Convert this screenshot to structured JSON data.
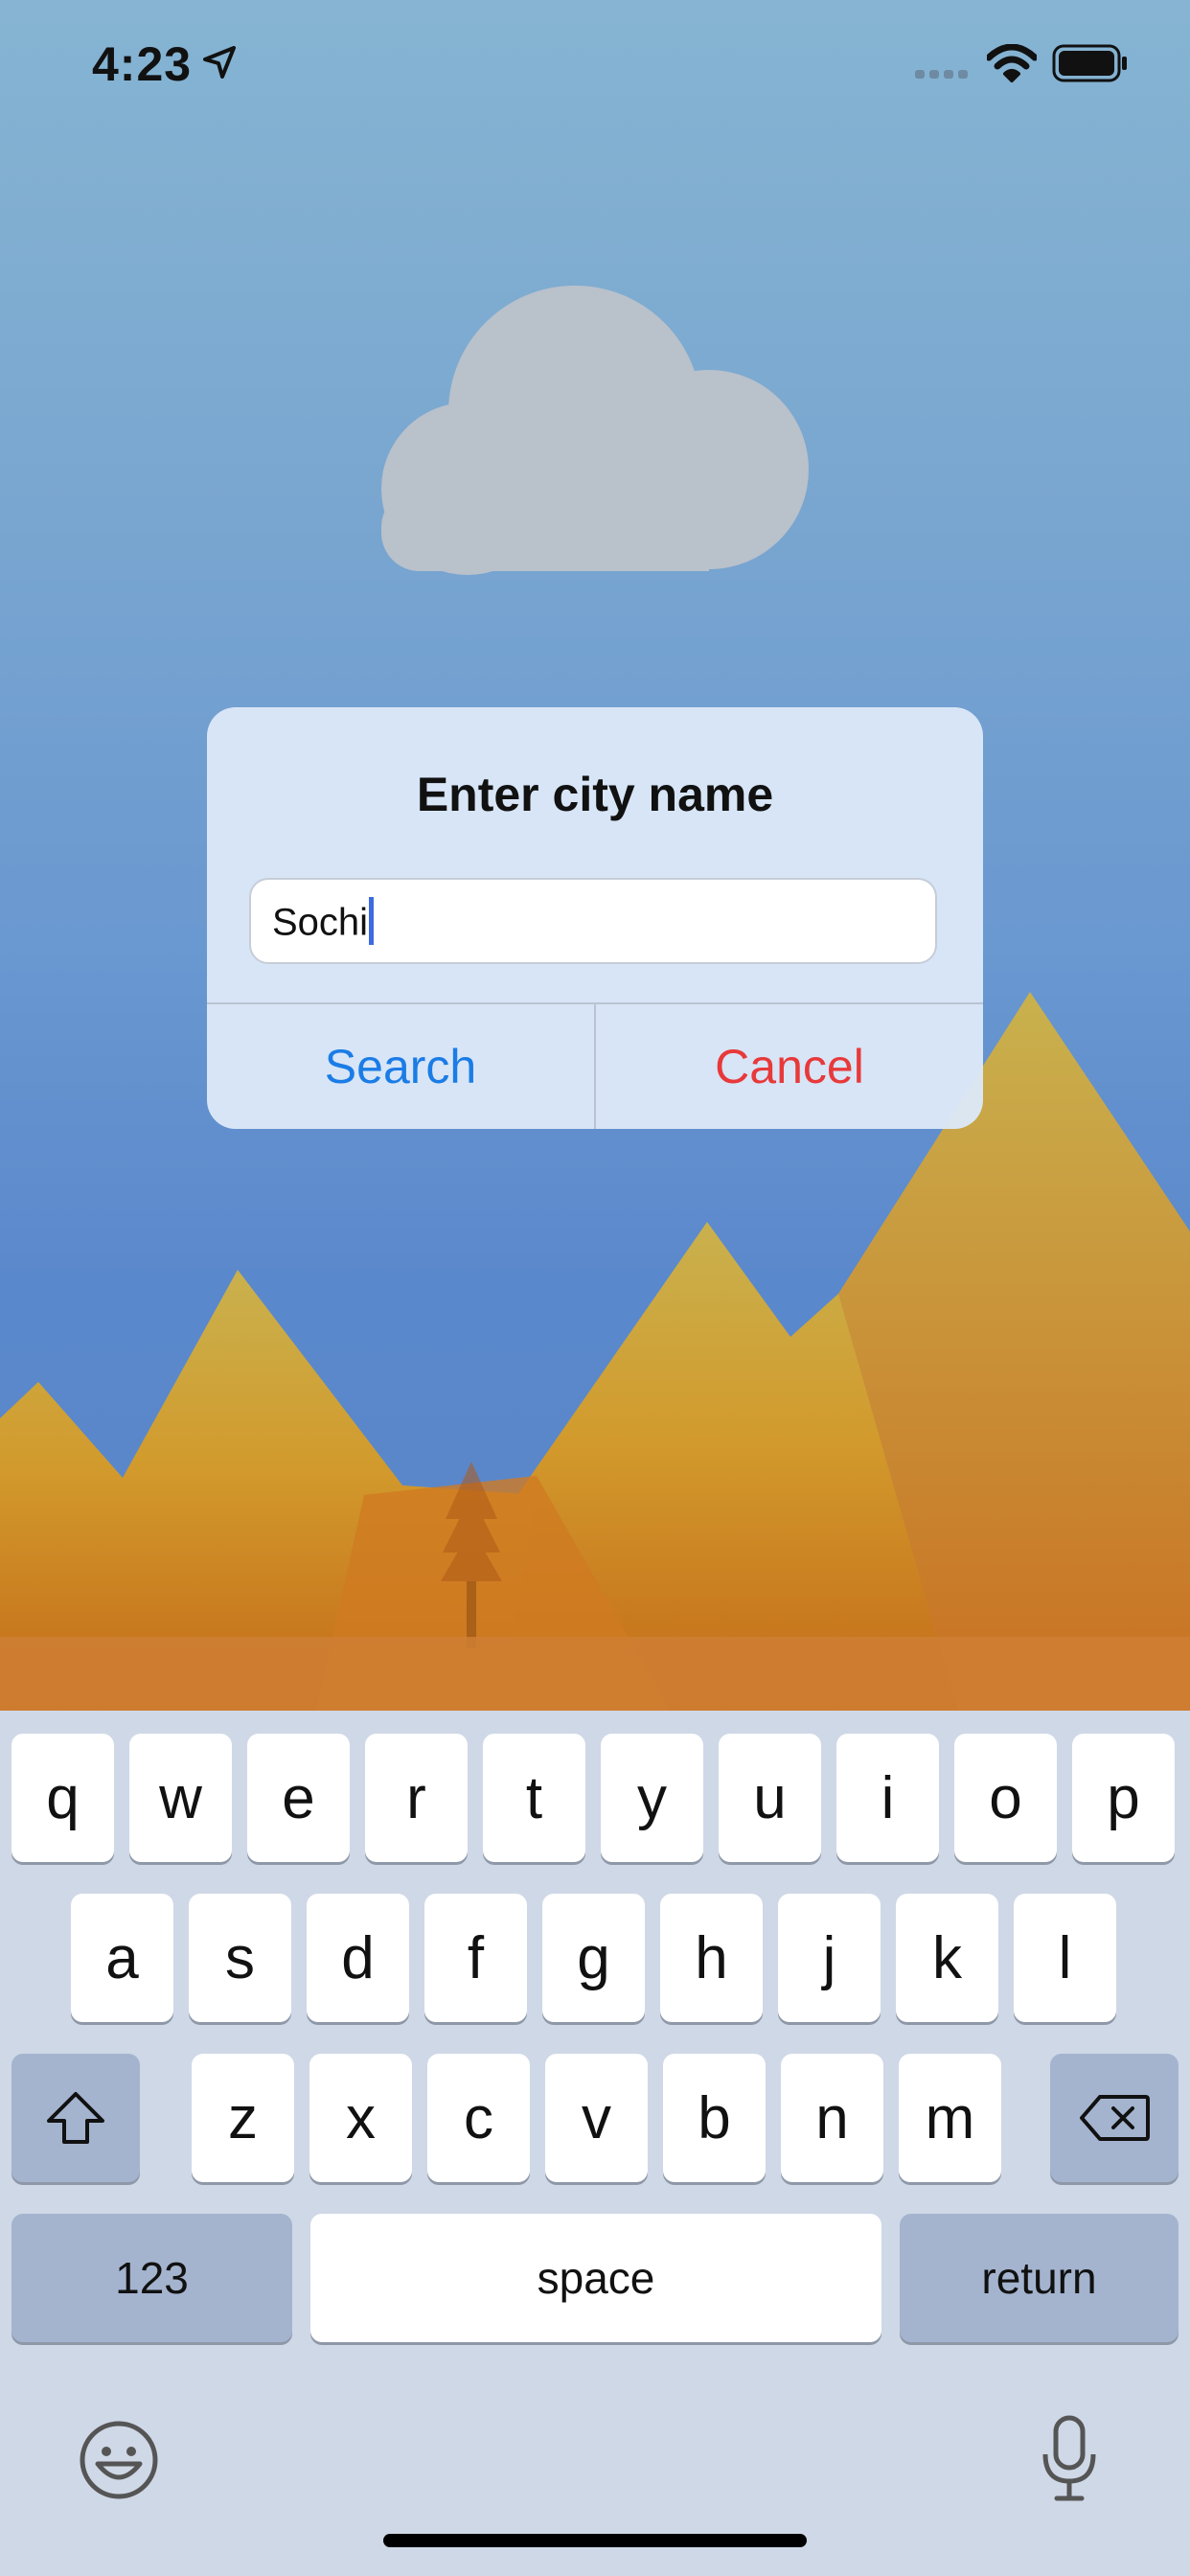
{
  "status_bar": {
    "time": "4:23",
    "icons": [
      "location-arrow-icon",
      "signal-icon",
      "wifi-icon",
      "battery-icon"
    ]
  },
  "background": {
    "sky_colors": [
      "#86b4d2",
      "#5a86c8"
    ],
    "mountain_colors": [
      "#c9b14e",
      "#c46a18"
    ],
    "cloud_color": "#b9c1cb"
  },
  "alert": {
    "title": "Enter city name",
    "field_value": "Sochi",
    "search_label": "Search",
    "cancel_label": "Cancel",
    "search_color": "#1b7ce6",
    "cancel_color": "#e8393a"
  },
  "keyboard": {
    "row1": [
      "q",
      "w",
      "e",
      "r",
      "t",
      "y",
      "u",
      "i",
      "o",
      "p"
    ],
    "row2": [
      "a",
      "s",
      "d",
      "f",
      "g",
      "h",
      "j",
      "k",
      "l"
    ],
    "row3": [
      "z",
      "x",
      "c",
      "v",
      "b",
      "n",
      "m"
    ],
    "numbers_label": "123",
    "space_label": "space",
    "return_label": "return",
    "icons": [
      "shift-icon",
      "delete-icon",
      "emoji-icon",
      "microphone-icon"
    ]
  }
}
